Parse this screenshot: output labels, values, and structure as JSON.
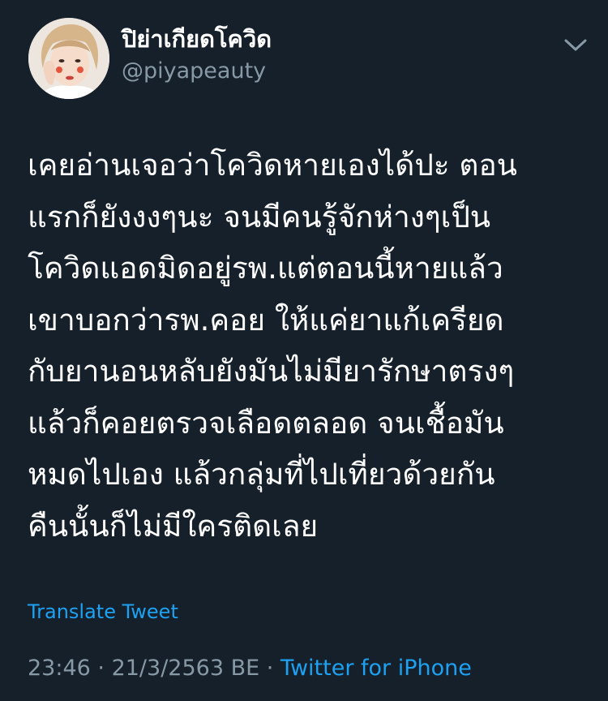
{
  "author": {
    "display_name": "ปิย่าเกียดโควิด",
    "handle": "@piyapeauty"
  },
  "tweet": {
    "lines": [
      "เคยอ่านเจอว่าโควิดหายเองได้ปะ ตอน",
      "แรกก็ยังงงๆนะ จนมีคนรู้จักห่างๆเป็น",
      "โควิดแอดมิดอยู่รพ.แต่ตอนนี้หายแล้ว",
      "เขาบอกว่ารพ.คอย ให้แค่ยาแก้เครียด",
      "กับยานอนหลับยังมันไม่มียารักษาตรงๆ",
      "แล้วก็คอยตรวจเลือดตลอด จนเชื้อมัน",
      "หมดไปเอง แล้วกลุ่มที่ไปเที่ยวด้วยกัน",
      "คืนนั้นก็ไม่มีใครติดเลย"
    ],
    "translate_label": "Translate Tweet"
  },
  "meta": {
    "time": "23:46",
    "separator": " · ",
    "date": "21/3/2563 BE",
    "source": "Twitter for iPhone"
  },
  "icons": {
    "menu": "chevron-down-icon",
    "avatar": "profile-photo"
  },
  "colors": {
    "background": "#15202b",
    "text": "#ffffff",
    "secondary": "#8899a6",
    "link": "#1da1f2"
  }
}
